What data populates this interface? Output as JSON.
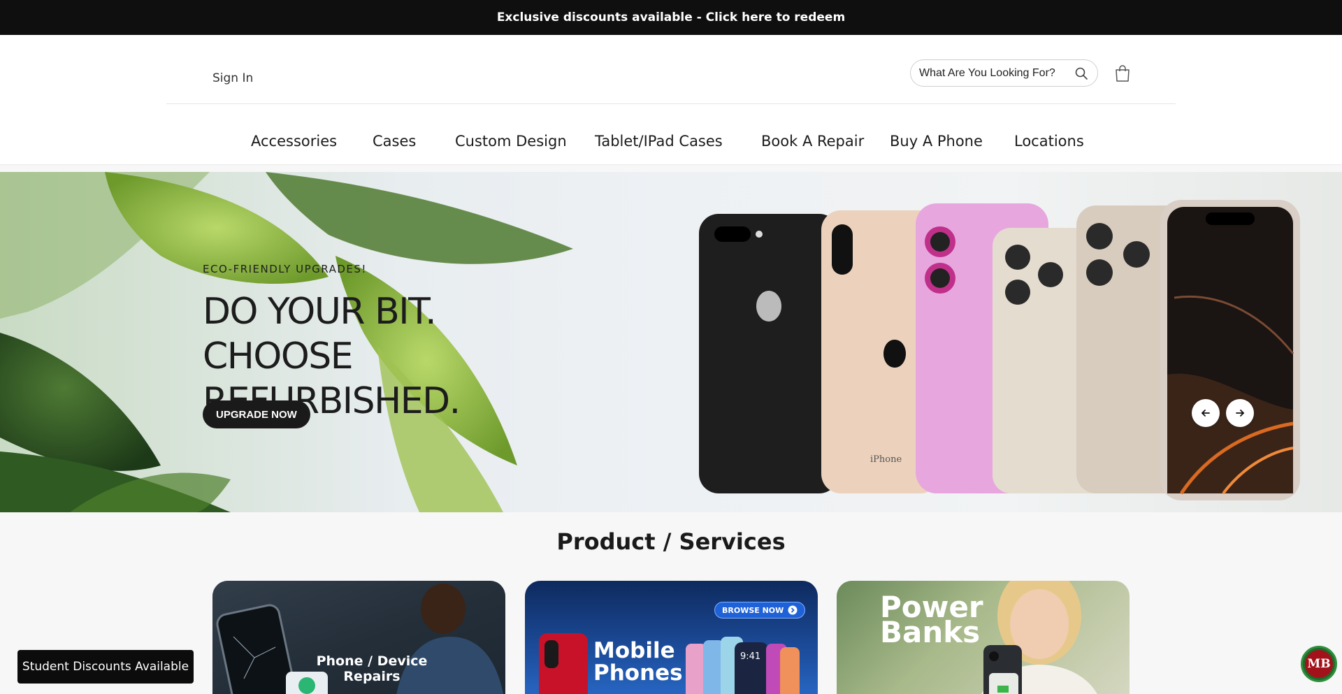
{
  "announcement": {
    "text": "Exclusive discounts available - Click here to redeem"
  },
  "header": {
    "sign_in": "Sign In",
    "search_placeholder": "What Are You Looking For?"
  },
  "nav": {
    "items": [
      {
        "label": "Accessories"
      },
      {
        "label": "Cases"
      },
      {
        "label": "Custom Design"
      },
      {
        "label": "Tablet/IPad Cases"
      },
      {
        "label": "Book A Repair"
      },
      {
        "label": "Buy A Phone"
      },
      {
        "label": "Locations"
      }
    ]
  },
  "hero": {
    "eyebrow": "ECO-FRIENDLY UPGRADES!",
    "headline": "DO YOUR BIT. CHOOSE REFURBISHED.",
    "cta": "UPGRADE NOW",
    "phone_back_text": "iPhone"
  },
  "products": {
    "title": "Product / Services",
    "cards": [
      {
        "label_line1": "Phone / Device",
        "label_line2": "Repairs"
      },
      {
        "badge": "BROWSE NOW",
        "label_line1": "Mobile",
        "label_line2": "Phones",
        "screen_time": "9:41"
      },
      {
        "label_line1": "Power",
        "label_line2": "Banks"
      }
    ]
  },
  "toast": {
    "text": "Student Discounts Available"
  },
  "chat_badge": {
    "initials": "MB"
  },
  "colors": {
    "announcement_bg": "#0f0f0f",
    "cta_bg": "#1a1a1a",
    "badge_green": "#2f8f3d",
    "badge_red": "#a3111a"
  },
  "icons": {
    "search": "search-icon",
    "cart": "shopping-bag-icon",
    "prev": "arrow-left-icon",
    "next": "arrow-right-icon"
  }
}
